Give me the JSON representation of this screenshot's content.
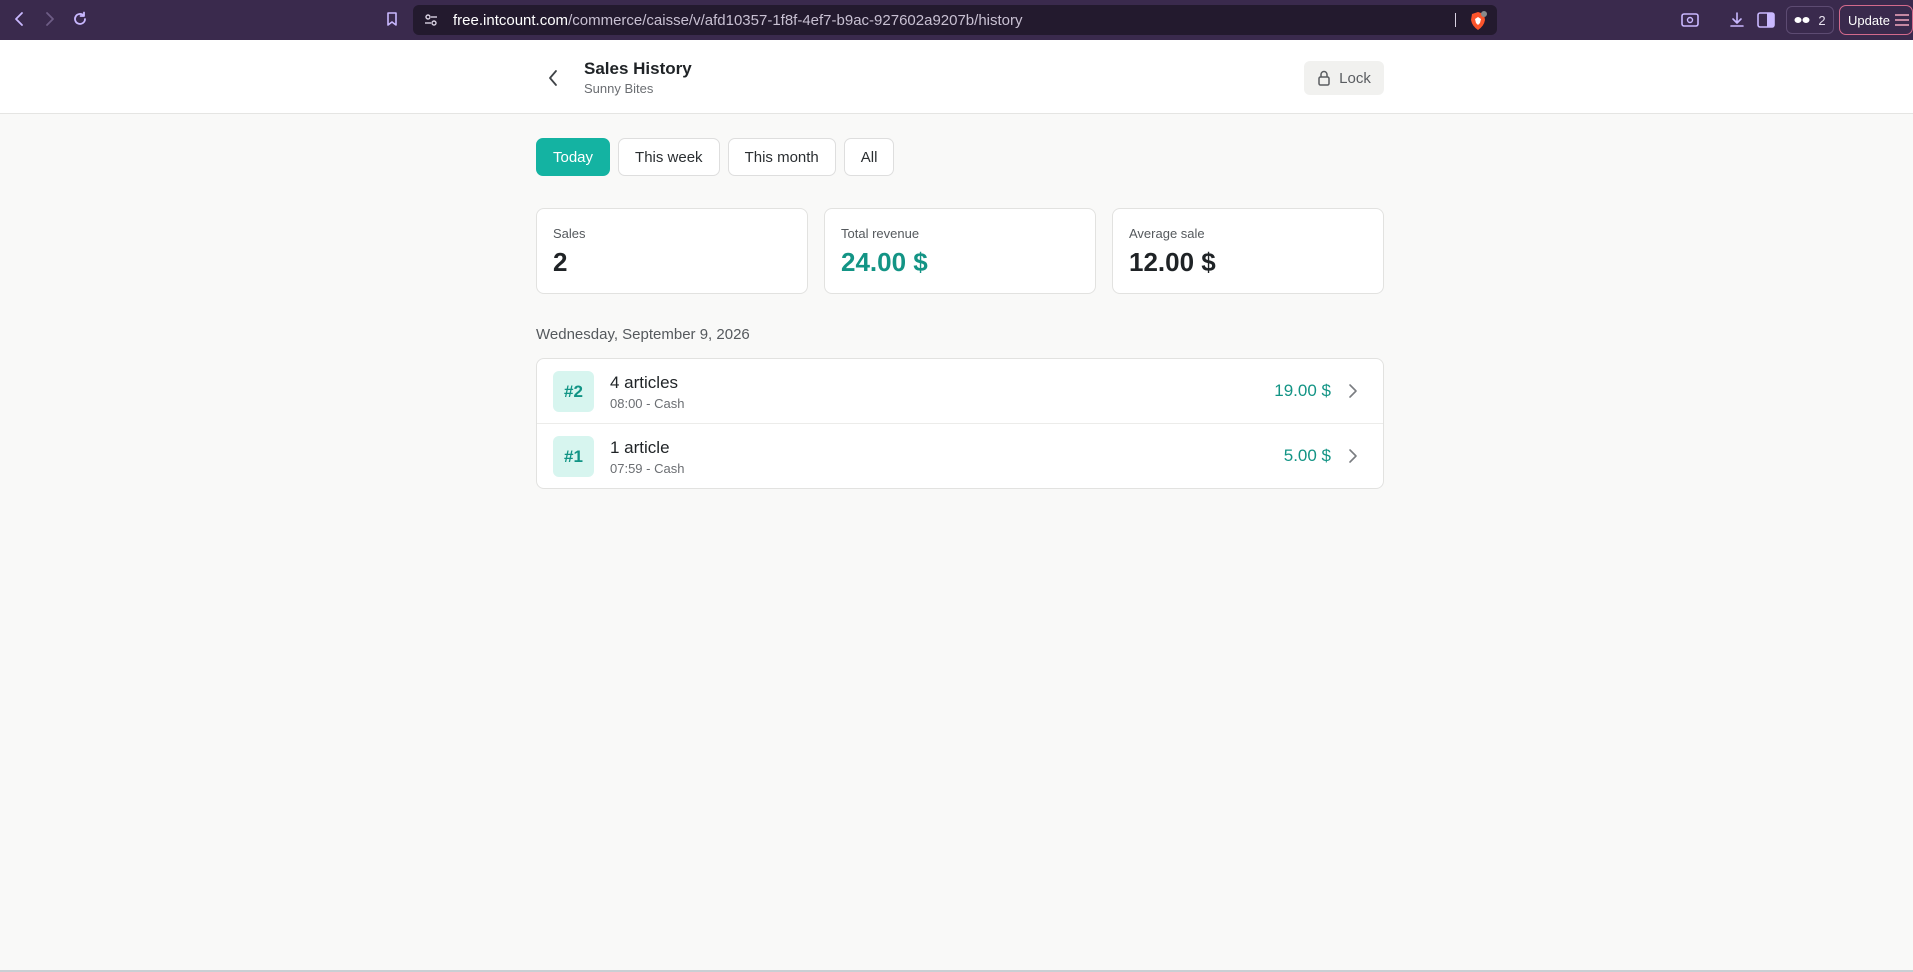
{
  "browser": {
    "url_host": "free.intcount.com",
    "url_path": "/commerce/caisse/v/afd10357-1f8f-4ef7-b9ac-927602a9207b/history",
    "wallet_count": "2",
    "update_label": "Update"
  },
  "header": {
    "title": "Sales History",
    "subtitle": "Sunny Bites",
    "lock_label": "Lock"
  },
  "filters": [
    {
      "label": "Today",
      "active": true
    },
    {
      "label": "This week",
      "active": false
    },
    {
      "label": "This month",
      "active": false
    },
    {
      "label": "All",
      "active": false
    }
  ],
  "stats": {
    "sales": {
      "label": "Sales",
      "value": "2"
    },
    "revenue": {
      "label": "Total revenue",
      "value": "24.00 $"
    },
    "average": {
      "label": "Average sale",
      "value": "12.00 $"
    }
  },
  "day": {
    "label": "Wednesday, September 9, 2026",
    "sales": [
      {
        "number": "#2",
        "title": "4 articles",
        "meta": "08:00 - Cash",
        "amount": "19.00 $"
      },
      {
        "number": "#1",
        "title": "1 article",
        "meta": "07:59 - Cash",
        "amount": "5.00 $"
      }
    ]
  },
  "colors": {
    "accent": "#14b3a2",
    "accent_text": "#139485",
    "browser_chrome": "#3a2a4d"
  }
}
